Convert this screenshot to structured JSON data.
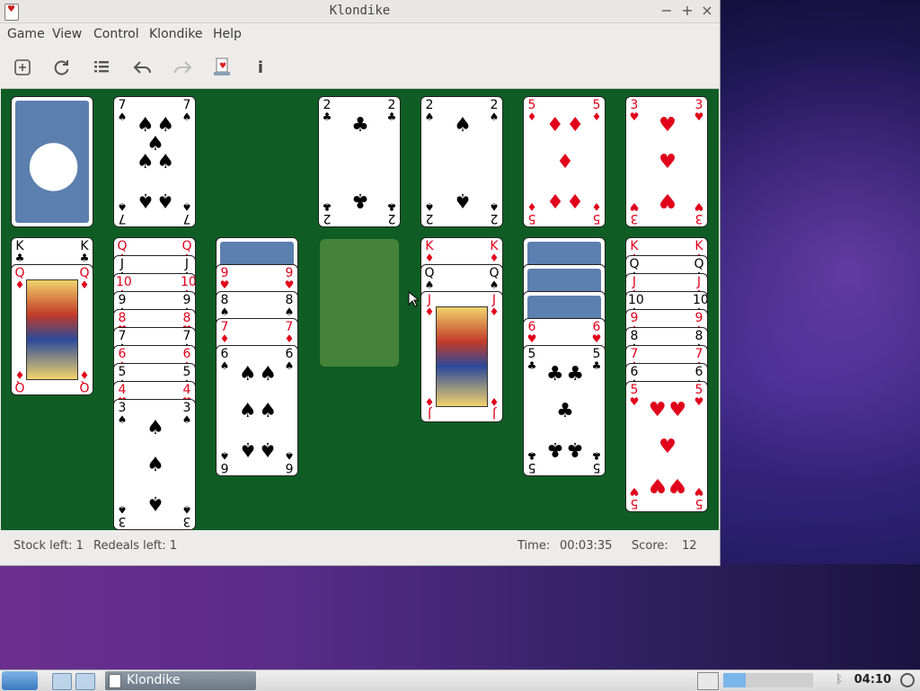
{
  "window": {
    "title": "Klondike",
    "min": "−",
    "max": "+",
    "close": "×"
  },
  "menu": [
    "Game",
    "View",
    "Control",
    "Klondike",
    "Help"
  ],
  "toolbar": [
    "new-game",
    "restart",
    "select-game",
    "undo",
    "redo",
    "deal",
    "info"
  ],
  "status": {
    "stock": "Stock left: 1",
    "redeals": "Redeals left: 1",
    "time_label": "Time:",
    "time": "00:03:35",
    "score_label": "Score:",
    "score": "12"
  },
  "taskbar": {
    "app": "Klondike",
    "clock": "04:10"
  },
  "colors": {
    "felt": "#0f5d24",
    "red": "#e0001b",
    "back": "#5b7fae"
  },
  "cards": {
    "waste": {
      "rank": "7",
      "suit": "♠"
    },
    "foundations": [
      {
        "rank": "2",
        "suit": "♣"
      },
      {
        "rank": "2",
        "suit": "♠"
      },
      {
        "rank": "5",
        "suit": "♦"
      },
      {
        "rank": "3",
        "suit": "♥"
      }
    ],
    "tableau": [
      {
        "hidden": 0,
        "cards": [
          {
            "rank": "K",
            "suit": "♣"
          },
          {
            "rank": "Q",
            "suit": "♦"
          }
        ]
      },
      {
        "hidden": 0,
        "cards": [
          {
            "rank": "Q",
            "suit": "♦"
          },
          {
            "rank": "J",
            "suit": "♠"
          },
          {
            "rank": "10",
            "suit": "♦"
          },
          {
            "rank": "9",
            "suit": "♠"
          },
          {
            "rank": "8",
            "suit": "♥"
          },
          {
            "rank": "7",
            "suit": "♠"
          },
          {
            "rank": "6",
            "suit": "♦"
          },
          {
            "rank": "5",
            "suit": "♠"
          },
          {
            "rank": "4",
            "suit": "♥"
          },
          {
            "rank": "3",
            "suit": "♠"
          }
        ]
      },
      {
        "hidden": 1,
        "cards": [
          {
            "rank": "9",
            "suit": "♥"
          },
          {
            "rank": "8",
            "suit": "♠"
          },
          {
            "rank": "7",
            "suit": "♦"
          },
          {
            "rank": "6",
            "suit": "♠"
          }
        ]
      },
      {
        "hidden": 0,
        "cards": []
      },
      {
        "hidden": 0,
        "cards": [
          {
            "rank": "K",
            "suit": "♦"
          },
          {
            "rank": "Q",
            "suit": "♠"
          },
          {
            "rank": "J",
            "suit": "♦"
          }
        ]
      },
      {
        "hidden": 3,
        "cards": [
          {
            "rank": "6",
            "suit": "♥"
          },
          {
            "rank": "5",
            "suit": "♣"
          }
        ]
      },
      {
        "hidden": 0,
        "cards": [
          {
            "rank": "K",
            "suit": "♦"
          },
          {
            "rank": "Q",
            "suit": "♠"
          },
          {
            "rank": "J",
            "suit": "♦"
          },
          {
            "rank": "10",
            "suit": "♠"
          },
          {
            "rank": "9",
            "suit": "♦"
          },
          {
            "rank": "8",
            "suit": "♠"
          },
          {
            "rank": "7",
            "suit": "♦"
          },
          {
            "rank": "6",
            "suit": "♠"
          },
          {
            "rank": "5",
            "suit": "♥"
          }
        ]
      }
    ]
  }
}
